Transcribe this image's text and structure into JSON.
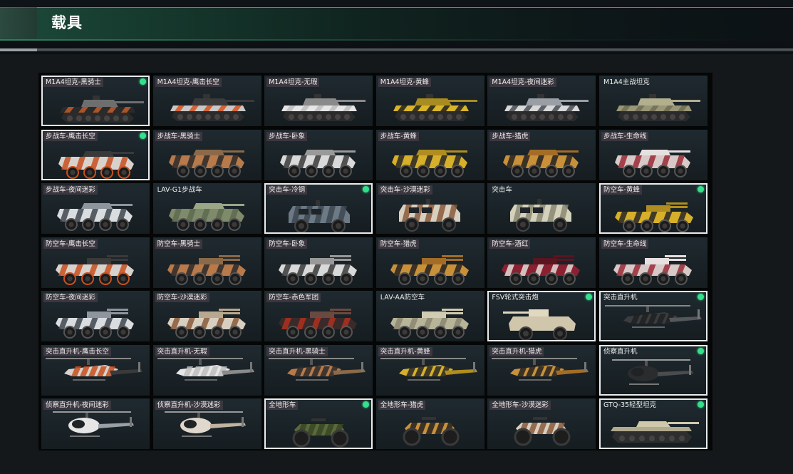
{
  "header": {
    "title": "载具"
  },
  "tiles": [
    {
      "label": "M1A4坦克-黑骑士",
      "kind": "tank",
      "camo": [
        "#2a2a2a",
        "#c25a2a",
        "#6e6e6e"
      ],
      "selected": true,
      "owned": true
    },
    {
      "label": "M1A4坦克-鹰击长空",
      "kind": "tank",
      "camo": [
        "#c8c8c8",
        "#d5521f",
        "#3a3a3a"
      ],
      "selected": false,
      "owned": false
    },
    {
      "label": "M1A4坦克-无瑕",
      "kind": "tank",
      "camo": [
        "#e6e6e6",
        "#bdbdbd",
        "#8a8a8a"
      ],
      "selected": false,
      "owned": false
    },
    {
      "label": "M1A4坦克-黄蜂",
      "kind": "tank",
      "camo": [
        "#d9b52a",
        "#1e1e1e",
        "#a88c1f"
      ],
      "selected": false,
      "owned": false
    },
    {
      "label": "M1A4坦克-夜间迷彩",
      "kind": "tank",
      "camo": [
        "#d8d8d8",
        "#4a4f55",
        "#9a9fa5"
      ],
      "selected": false,
      "owned": false
    },
    {
      "label": "M1A4主战坦克",
      "kind": "tank",
      "camo": [
        "#9a9778",
        "#6f6d55",
        "#b2af8f"
      ],
      "selected": false,
      "owned": false
    },
    {
      "label": "步战车-鹰击长空",
      "kind": "ifv",
      "camo": [
        "#d8d2cc",
        "#c9501e",
        "#3a3a3a"
      ],
      "selected": true,
      "owned": true
    },
    {
      "label": "步战车-黑骑士",
      "kind": "ifv",
      "camo": [
        "#b87a4a",
        "#2a2a2a",
        "#8a6a4a"
      ],
      "selected": false,
      "owned": false
    },
    {
      "label": "步战车-卧象",
      "kind": "ifv",
      "camo": [
        "#d9d9d9",
        "#3a3a3a",
        "#999999"
      ],
      "selected": false,
      "owned": false
    },
    {
      "label": "步战车-黄蜂",
      "kind": "ifv",
      "camo": [
        "#d6b02a",
        "#262626",
        "#b08d20"
      ],
      "selected": false,
      "owned": false
    },
    {
      "label": "步战车-猎虎",
      "kind": "ifv",
      "camo": [
        "#c9903a",
        "#222222",
        "#a36d28"
      ],
      "selected": false,
      "owned": false
    },
    {
      "label": "步战车-生命线",
      "kind": "ifv",
      "camo": [
        "#d8c9c9",
        "#9a2a35",
        "#e6e0e0"
      ],
      "selected": false,
      "owned": false
    },
    {
      "label": "步战车-夜间迷彩",
      "kind": "ifv",
      "camo": [
        "#dadde0",
        "#3f464d",
        "#8e959c"
      ],
      "selected": false,
      "owned": false
    },
    {
      "label": "LAV-G1步战车",
      "kind": "ifv",
      "camo": [
        "#7e8a6a",
        "#5e6a4e",
        "#9aa685"
      ],
      "selected": false,
      "owned": false
    },
    {
      "label": "突击车-冷钢",
      "kind": "truck",
      "camo": [
        "#6c7a86",
        "#3c4650",
        "#9aa6b0"
      ],
      "selected": true,
      "owned": true
    },
    {
      "label": "突击车-沙漠迷彩",
      "kind": "truck",
      "camo": [
        "#d9cfc0",
        "#8a5a3a",
        "#b8a890"
      ],
      "selected": false,
      "owned": false
    },
    {
      "label": "突击车",
      "kind": "truck",
      "camo": [
        "#d4d2bc",
        "#8a8870",
        "#b5b39a"
      ],
      "selected": false,
      "owned": false
    },
    {
      "label": "防空车-黄蜂",
      "kind": "aa",
      "camo": [
        "#d6b02a",
        "#262626",
        "#b08d20"
      ],
      "selected": true,
      "owned": true
    },
    {
      "label": "防空车-鹰击长空",
      "kind": "aa",
      "camo": [
        "#d8d2cc",
        "#c9501e",
        "#3a3a3a"
      ],
      "selected": false,
      "owned": false
    },
    {
      "label": "防空车-黑骑士",
      "kind": "aa",
      "camo": [
        "#b87a4a",
        "#2a2a2a",
        "#8a6a4a"
      ],
      "selected": false,
      "owned": false
    },
    {
      "label": "防空车-卧象",
      "kind": "aa",
      "camo": [
        "#d9d9d9",
        "#3a3a3a",
        "#999999"
      ],
      "selected": false,
      "owned": false
    },
    {
      "label": "防空车-猎虎",
      "kind": "aa",
      "camo": [
        "#c9903a",
        "#222222",
        "#a36d28"
      ],
      "selected": false,
      "owned": false
    },
    {
      "label": "防空车-酒红",
      "kind": "aa",
      "camo": [
        "#8a2030",
        "#e0dcd6",
        "#5a1520"
      ],
      "selected": false,
      "owned": false
    },
    {
      "label": "防空车-生命线",
      "kind": "aa",
      "camo": [
        "#d8c9c9",
        "#9a2a35",
        "#e6e0e0"
      ],
      "selected": false,
      "owned": false
    },
    {
      "label": "防空车-夜间迷彩",
      "kind": "aa",
      "camo": [
        "#dadde0",
        "#3f464d",
        "#8e959c"
      ],
      "selected": false,
      "owned": false
    },
    {
      "label": "防空车-沙漠迷彩",
      "kind": "aa",
      "camo": [
        "#d9cfc0",
        "#8a5a3a",
        "#b8a890"
      ],
      "selected": false,
      "owned": false
    },
    {
      "label": "防空车-赤色军团",
      "kind": "aa",
      "camo": [
        "#3a2a2a",
        "#b0301e",
        "#6a4a40"
      ],
      "selected": false,
      "owned": false
    },
    {
      "label": "LAV-AA防空车",
      "kind": "aa",
      "camo": [
        "#b8b49a",
        "#8a8670",
        "#d0ccb2"
      ],
      "selected": false,
      "owned": false
    },
    {
      "label": "FSV轮式突击炮",
      "kind": "fsv",
      "camo": [
        "#cfc6ac",
        "#9a9078",
        "#e0d8c0"
      ],
      "selected": true,
      "owned": true
    },
    {
      "label": "突击直升机",
      "kind": "heli",
      "camo": [
        "#3a3c3e",
        "#1f2022",
        "#55585a"
      ],
      "selected": true,
      "owned": true
    },
    {
      "label": "突击直升机-鹰击长空",
      "kind": "heli",
      "camo": [
        "#d8d2cc",
        "#c9501e",
        "#3a3a3a"
      ],
      "selected": false,
      "owned": false
    },
    {
      "label": "突击直升机-无瑕",
      "kind": "heli",
      "camo": [
        "#e6e6e6",
        "#bdbdbd",
        "#8a8a8a"
      ],
      "selected": false,
      "owned": false
    },
    {
      "label": "突击直升机-黑骑士",
      "kind": "heli",
      "camo": [
        "#b87a4a",
        "#2a2a2a",
        "#8a6a4a"
      ],
      "selected": false,
      "owned": false
    },
    {
      "label": "突击直升机-黄蜂",
      "kind": "heli",
      "camo": [
        "#d6b02a",
        "#262626",
        "#b08d20"
      ],
      "selected": false,
      "owned": false
    },
    {
      "label": "突击直升机-猎虎",
      "kind": "heli",
      "camo": [
        "#c9903a",
        "#222222",
        "#a36d28"
      ],
      "selected": false,
      "owned": false
    },
    {
      "label": "侦察直升机",
      "kind": "scout",
      "camo": [
        "#2a2c2e",
        "#1a1b1c",
        "#4a4c4e"
      ],
      "selected": true,
      "owned": true
    },
    {
      "label": "侦察直升机-夜间迷彩",
      "kind": "scout",
      "camo": [
        "#e6e6e6",
        "#3f464d",
        "#9aa0a6"
      ],
      "selected": false,
      "owned": false
    },
    {
      "label": "侦察直升机-沙漠迷彩",
      "kind": "scout",
      "camo": [
        "#e0d8cc",
        "#8a5a3a",
        "#c0b4a0"
      ],
      "selected": false,
      "owned": false
    },
    {
      "label": "全地形车",
      "kind": "atv",
      "camo": [
        "#5a6a3a",
        "#3a4526",
        "#78885a"
      ],
      "selected": true,
      "owned": true
    },
    {
      "label": "全地形车-猎虎",
      "kind": "atv",
      "camo": [
        "#c9903a",
        "#222222",
        "#a36d28"
      ],
      "selected": false,
      "owned": false
    },
    {
      "label": "全地形车-沙漠迷彩",
      "kind": "atv",
      "camo": [
        "#d9cfc0",
        "#8a5a3a",
        "#b8a890"
      ],
      "selected": false,
      "owned": false
    },
    {
      "label": "GTQ-35轻型坦克",
      "kind": "lighttank",
      "camo": [
        "#b0aa8e",
        "#7a7560",
        "#cfc9ac"
      ],
      "selected": true,
      "owned": true
    }
  ]
}
